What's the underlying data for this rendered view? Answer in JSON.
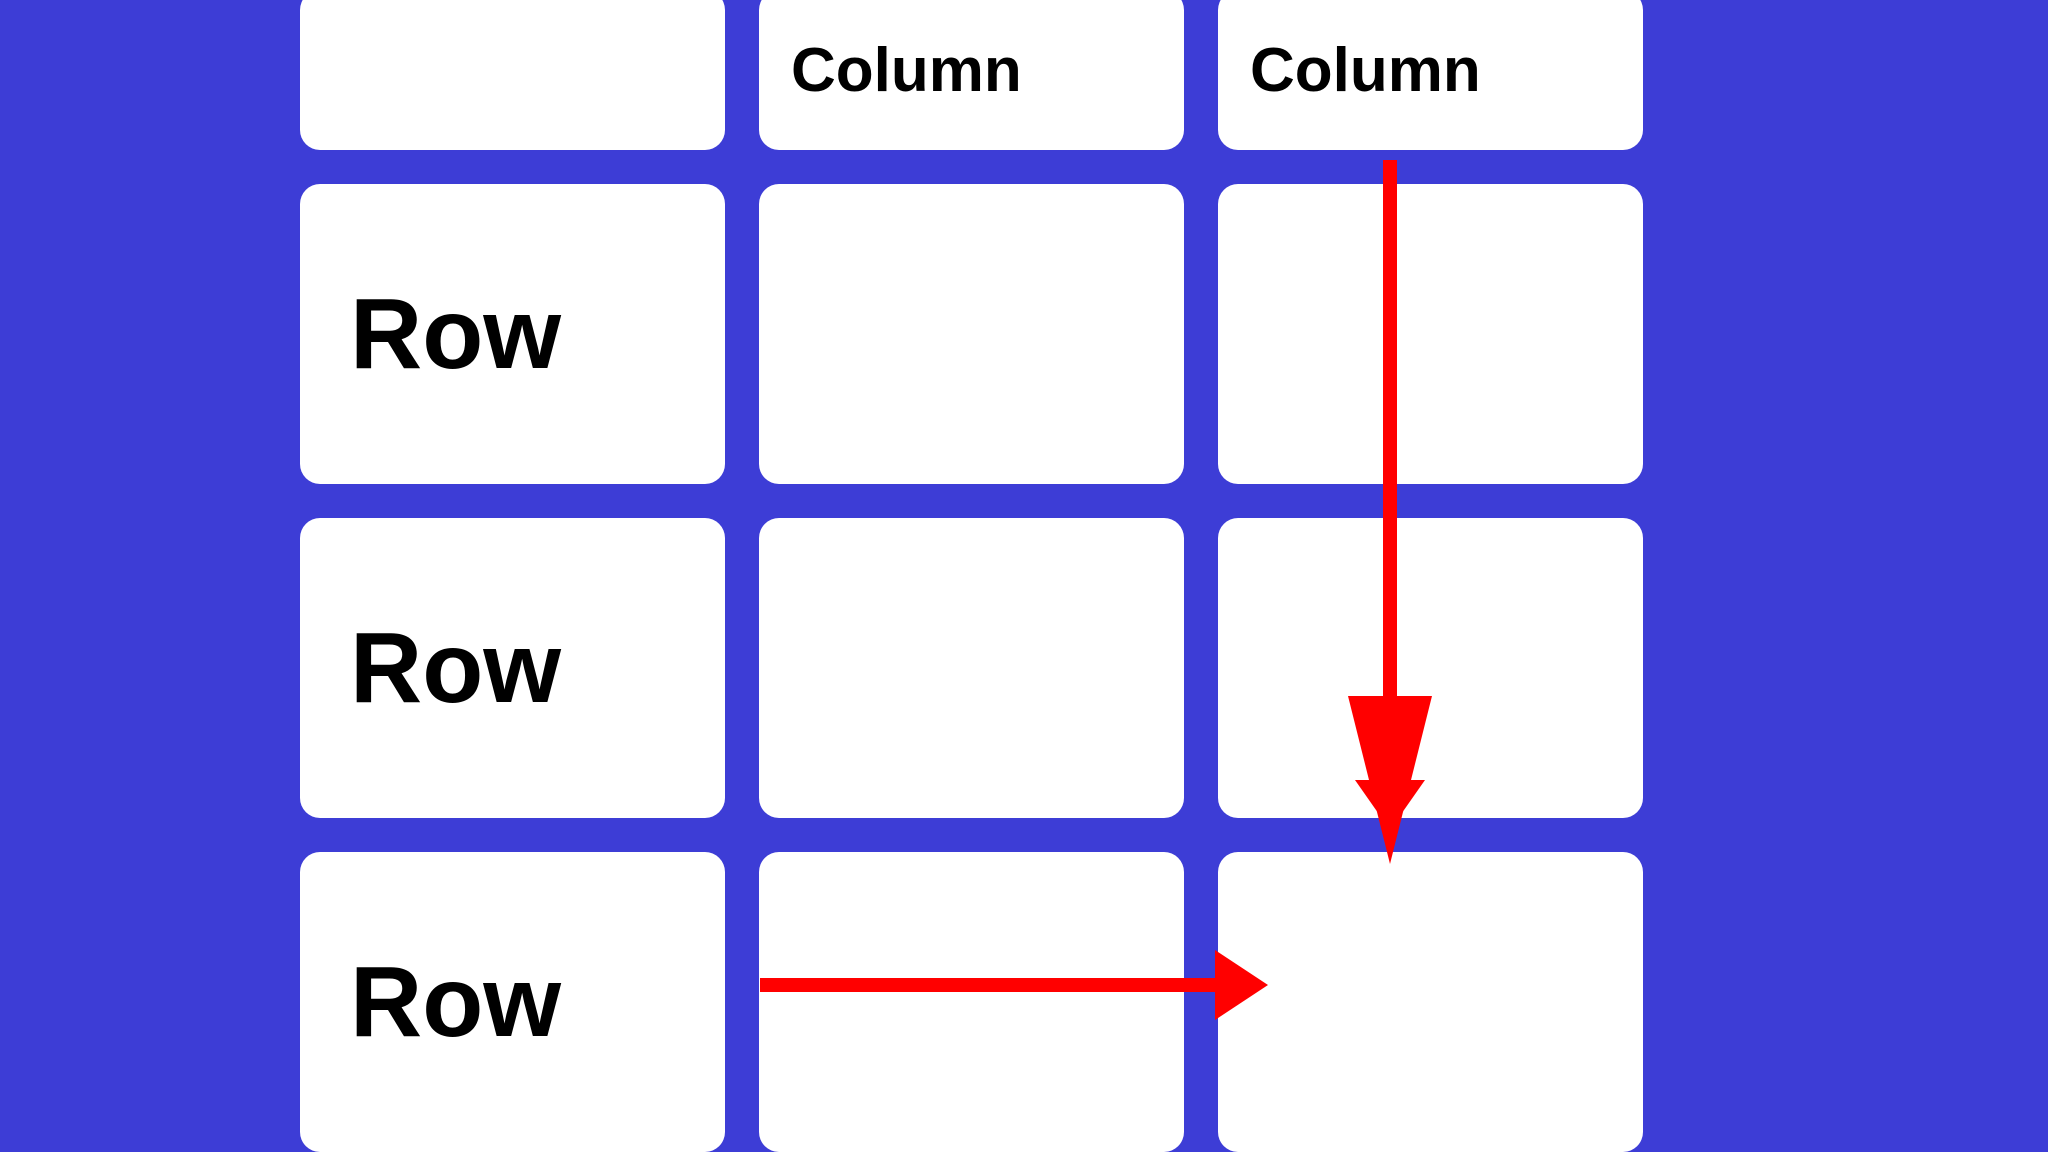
{
  "table": {
    "columns": [
      "Column",
      "Column"
    ],
    "rows": [
      "Row",
      "Row",
      "Row"
    ]
  },
  "arrows": {
    "vertical_color": "#ff0000",
    "horizontal_color": "#ff0000"
  }
}
